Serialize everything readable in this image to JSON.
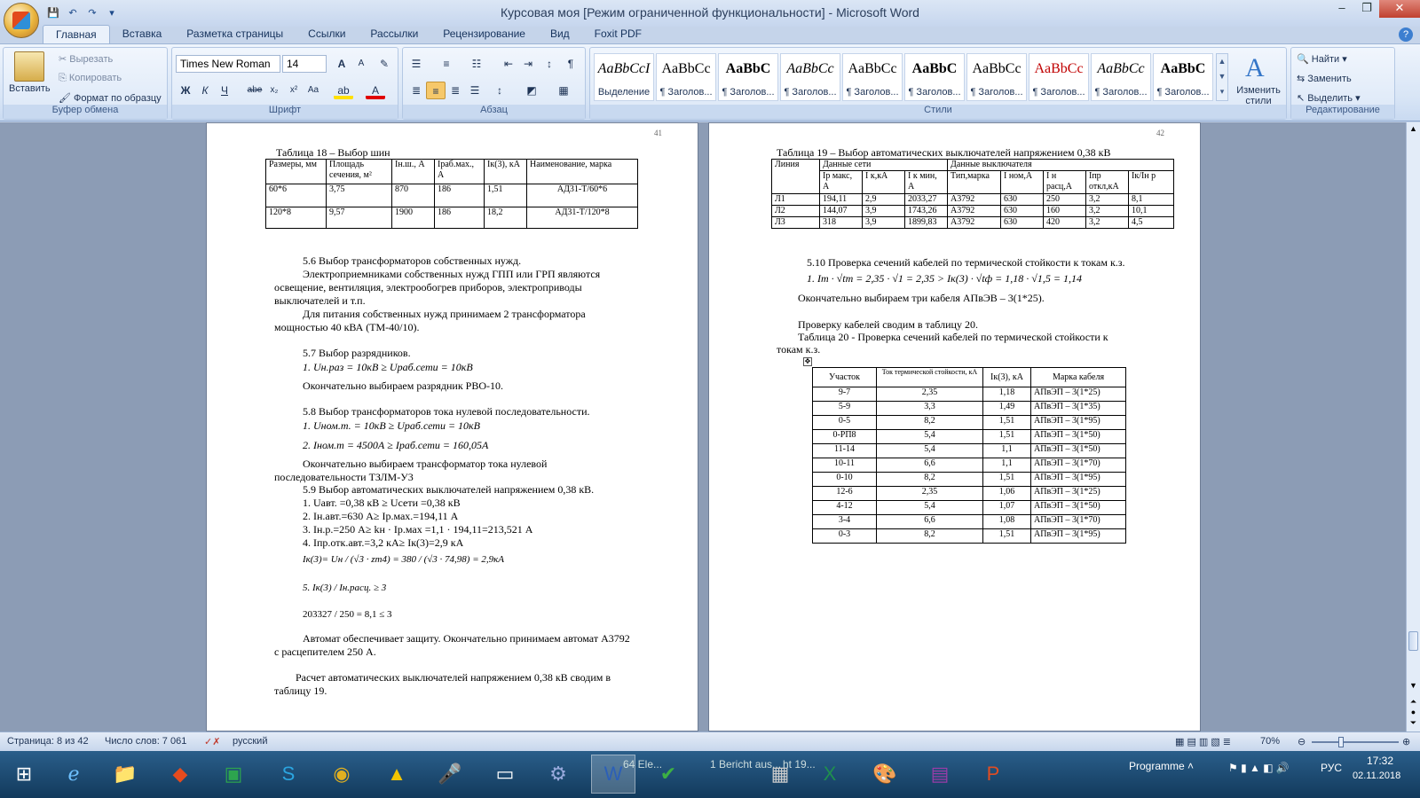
{
  "window": {
    "title": "Курсовая моя [Режим ограниченной функциональности] - Microsoft Word"
  },
  "tabs": [
    "Главная",
    "Вставка",
    "Разметка страницы",
    "Ссылки",
    "Рассылки",
    "Рецензирование",
    "Вид",
    "Foxit PDF"
  ],
  "ribbon": {
    "clipboard": {
      "paste": "Вставить",
      "cut": "Вырезать",
      "copy": "Копировать",
      "format_painter": "Формат по образцу",
      "label": "Буфер обмена"
    },
    "font": {
      "font_name": "Times New Roman",
      "font_size": "14",
      "label": "Шрифт"
    },
    "paragraph": {
      "label": "Абзац"
    },
    "styles": {
      "label": "Стили",
      "items": [
        {
          "sample": "AaBbCcI",
          "name": "Выделение"
        },
        {
          "sample": "AaBbCc",
          "name": "¶ Заголов..."
        },
        {
          "sample": "AaBbC",
          "name": "¶ Заголов..."
        },
        {
          "sample": "AaBbCc",
          "name": "¶ Заголов..."
        },
        {
          "sample": "AaBbCc",
          "name": "¶ Заголов..."
        },
        {
          "sample": "AaBbC",
          "name": "¶ Заголов..."
        },
        {
          "sample": "AaBbCc",
          "name": "¶ Заголов..."
        },
        {
          "sample": "AaBbCc",
          "name": "¶ Заголов..."
        },
        {
          "sample": "AaBbCc",
          "name": "¶ Заголов..."
        },
        {
          "sample": "AaBbC",
          "name": "¶ Заголов..."
        }
      ],
      "change_styles": "Изменить стили"
    },
    "editing": {
      "find": "Найти",
      "replace": "Заменить",
      "select": "Выделить",
      "label": "Редактирование"
    }
  },
  "page_left": {
    "page_number": "41",
    "table18_title": "Таблица 18 – Выбор шин",
    "table18": {
      "headers": [
        "Размеры, мм",
        "Площадь сечения, м²",
        "Iн.ш., А",
        "Iраб.мах., А",
        "Iк(3), кА",
        "Наименование, марка"
      ],
      "rows": [
        [
          "60*6",
          "3,75",
          "870",
          "186",
          "1,51",
          "АД31-Т/60*6"
        ],
        [
          "120*8",
          "9,57",
          "1900",
          "186",
          "18,2",
          "АД31-Т/120*8"
        ]
      ]
    },
    "lines": [
      "5.6 Выбор трансформаторов собственных нужд.",
      "Электроприемниками собственных нужд ГПП или ГРП являются",
      "освещение, вентиляция, электрообогрев приборов, электроприводы",
      "выключателей и т.п.",
      "Для питания собственных нужд принимаем 2 трансформатора",
      "мощностью 40 кВА (ТМ-40/10).",
      "5.7 Выбор разрядников.",
      "1. Uн.раз = 10кВ ≥ Uраб.сети = 10кВ",
      "Окончательно выбираем разрядник РВО-10.",
      "5.8 Выбор трансформаторов тока нулевой последовательности.",
      "1. Uном.т. = 10кВ ≥ Uраб.сети = 10кВ",
      "2. Iном.т = 4500А ≥ Iраб.сети = 160,05А",
      "Окончательно выбираем трансформатор тока нулевой",
      "последовательности ТЗЛМ-У3",
      "5.9 Выбор автоматических выключателей напряжением 0,38 кВ.",
      "1. Uавт. =0,38 кВ ≥ Uсети =0,38 кВ",
      "2. Iн.авт.=630 А≥ Iр.мах.=194,11 А",
      "3. Iн.р.=250 А≥ kн · Iр.мах =1,1 · 194,11=213,521 А",
      "4. Iпр.отк.авт.=3,2 кА≥ Iк(3)=2,9 кА",
      "Iк(3)= Uн / (√3 · zт4) = 380 / (√3 · 74,98) = 2,9кА",
      "5. Iк(3) / Iн.расц. ≥ 3",
      "203327 / 250 = 8,1 ≤ 3",
      "Автомат обеспечивает защиту. Окончательно принимаем автомат А3792",
      "с расцепителем 250 А.",
      "Расчет автоматических выключателей напряжением 0,38 кВ сводим в",
      "таблицу 19."
    ]
  },
  "page_right": {
    "page_number": "42",
    "table19_title": "Таблица 19 – Выбор автоматических выключателей напряжением 0,38 кВ",
    "table19": {
      "group_headers": [
        "Линия",
        "Данные сети",
        "Данные выключателя"
      ],
      "headers": [
        "Iр макс, А",
        "I к,кА",
        "I к мин, А",
        "Тип,марка",
        "I ном,А",
        "I н расц,А",
        "Iпр откл,кА",
        "Iк/Iн р"
      ],
      "rows": [
        [
          "Л1",
          "194,11",
          "2,9",
          "2033,27",
          "А3792",
          "630",
          "250",
          "3,2",
          "8,1"
        ],
        [
          "Л2",
          "144,07",
          "3,9",
          "1743,26",
          "А3792",
          "630",
          "160",
          "3,2",
          "10,1"
        ],
        [
          "Л3",
          "318",
          "3,9",
          "1899,83",
          "А3792",
          "630",
          "420",
          "3,2",
          "4,5"
        ]
      ]
    },
    "section": "5.10 Проверка сечений кабелей по термической стойкости к токам к.з.",
    "formula": "1. Iт · √tт = 2,35 · √1 = 2,35 > Iк(3) · √tф = 1,18 · √1,5 = 1,14",
    "final_choice": "Окончательно выбираем три кабеля АПвЭВ – 3(1*25).",
    "summary": "Проверку кабелей сводим в таблицу 20.",
    "table20_title_1": "Таблица 20 - Проверка сечений кабелей по термической стойкости к",
    "table20_title_2": "токам к.з.",
    "table20": {
      "headers": [
        "Участок",
        "Ток термической стойкости, кА",
        "Iк(3), кА",
        "Марка кабеля"
      ],
      "rows": [
        [
          "9-7",
          "2,35",
          "1,18",
          "АПвЭП – 3(1*25)"
        ],
        [
          "5-9",
          "3,3",
          "1,49",
          "АПвЭП – 3(1*35)"
        ],
        [
          "0-5",
          "8,2",
          "1,51",
          "АПвЭП – 3(1*95)"
        ],
        [
          "0-РП8",
          "5,4",
          "1,51",
          "АПвЭП – 3(1*50)"
        ],
        [
          "11-14",
          "5,4",
          "1,1",
          "АПвЭП – 3(1*50)"
        ],
        [
          "10-11",
          "6,6",
          "1,1",
          "АПвЭП – 3(1*70)"
        ],
        [
          "0-10",
          "8,2",
          "1,51",
          "АПвЭП – 3(1*95)"
        ],
        [
          "12-6",
          "2,35",
          "1,06",
          "АПвЭП – 3(1*25)"
        ],
        [
          "4-12",
          "5,4",
          "1,07",
          "АПвЭП – 3(1*50)"
        ],
        [
          "3-4",
          "6,6",
          "1,08",
          "АПвЭП – 3(1*70)"
        ],
        [
          "0-3",
          "8,2",
          "1,51",
          "АПвЭП – 3(1*95)"
        ]
      ]
    }
  },
  "status": {
    "page": "Страница: 8 из 42",
    "words": "Число слов: 7 061",
    "lang": "русский",
    "zoom": "70%"
  },
  "taskbar": {
    "programme": "Programme",
    "lang": "РУС",
    "time": "17:32",
    "date": "02.11.2018",
    "item1": "64 Ele...",
    "item2": "1 Bericht aus...",
    "item3": "ht 19..."
  }
}
